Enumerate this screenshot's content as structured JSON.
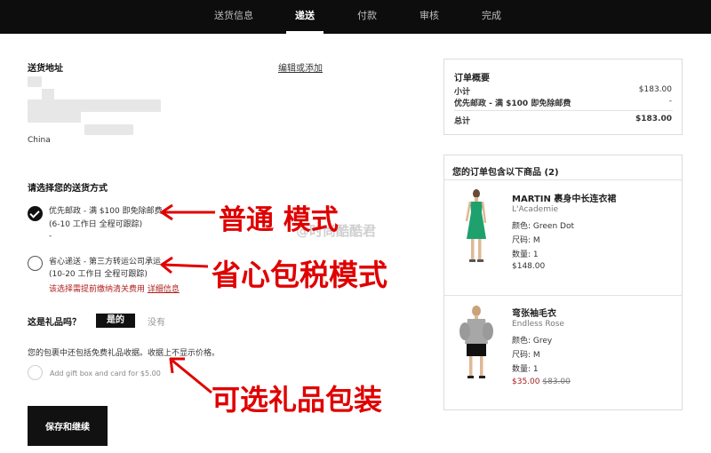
{
  "steps": [
    "送货信息",
    "递送",
    "付款",
    "审核",
    "完成"
  ],
  "shipping_address": {
    "title": "送货地址",
    "edit_link": "编辑或添加",
    "country": "China"
  },
  "delivery": {
    "title": "请选择您的送货方式",
    "options": [
      {
        "line1": "优先邮政 - 满 $100 即免除邮费",
        "line2": "(6-10 工作日 全程可跟踪)",
        "extra": "-"
      },
      {
        "line1": "省心递送 - 第三方转运公司承运",
        "line2": "(10-20 工作日 全程可跟踪)",
        "note": "该选择需提前缴纳清关费用",
        "note_link": "详细信息"
      }
    ]
  },
  "gift": {
    "question": "这是礼品吗？",
    "yes": "是的",
    "no": "没有",
    "info": "您的包裹中还包括免费礼品收据。收据上不显示价格。",
    "add_box": "Add gift box and card for $5.00"
  },
  "save_button": "保存和继续",
  "order_summary": {
    "title": "订单概要",
    "rows": [
      {
        "label": "小计",
        "value": "$183.00"
      },
      {
        "label": "优先邮政 - 满 $100 即免除邮费",
        "value": "-"
      },
      {
        "label": "总计",
        "value": "$183.00"
      }
    ]
  },
  "items_box": {
    "title": "您的订单包含以下商品 (2)",
    "items": [
      {
        "name": "MARTIN 裹身中长连衣裙",
        "brand": "L'Academie",
        "color": "颜色: Green Dot",
        "size": "尺码: M",
        "qty": "数量: 1",
        "price": "$148.00"
      },
      {
        "name": "弯张袖毛衣",
        "brand": "Endless Rose",
        "color": "颜色: Grey",
        "size": "尺码: M",
        "qty": "数量: 1",
        "price_sale": "$35.00",
        "price_orig": "$83.00"
      }
    ]
  },
  "annotations": {
    "normal": "普通  模式",
    "carefree": "省心包税模式",
    "gift_wrap": "可选礼品包装",
    "watermark": "@时尚酷酷君"
  },
  "colors": {
    "accent": "#e00000",
    "dark": "#111111"
  }
}
